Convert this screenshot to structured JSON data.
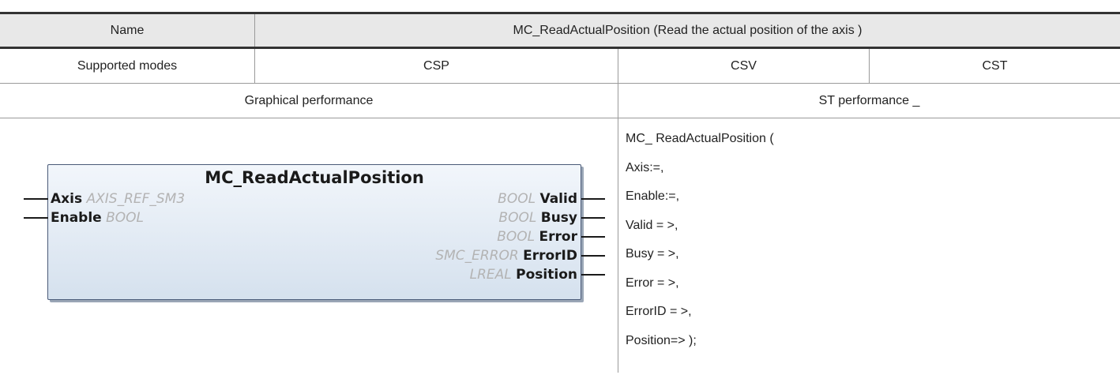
{
  "table": {
    "header": {
      "name_label": "Name",
      "title": "MC_ReadActualPosition (Read the actual position of the axis )"
    },
    "modes": {
      "label": "Supported modes",
      "csp": "CSP",
      "csv": "CSV",
      "cst": "CST"
    },
    "sections": {
      "graphical": "Graphical performance",
      "st": "ST performance _"
    }
  },
  "function_block": {
    "name": "MC_ReadActualPosition",
    "inputs": [
      {
        "name": "Axis",
        "type": "AXIS_REF_SM3"
      },
      {
        "name": "Enable",
        "type": "BOOL"
      }
    ],
    "outputs": [
      {
        "name": "Valid",
        "type": "BOOL"
      },
      {
        "name": "Busy",
        "type": "BOOL"
      },
      {
        "name": "Error",
        "type": "BOOL"
      },
      {
        "name": "ErrorID",
        "type": "SMC_ERROR"
      },
      {
        "name": "Position",
        "type": "LREAL"
      }
    ]
  },
  "st_code": [
    "MC_ ReadActualPosition (",
    "Axis:=,",
    "Enable:=,",
    "Valid = >,",
    "Busy = >,",
    "Error = >,",
    "ErrorID = >,",
    "Position=> );"
  ]
}
